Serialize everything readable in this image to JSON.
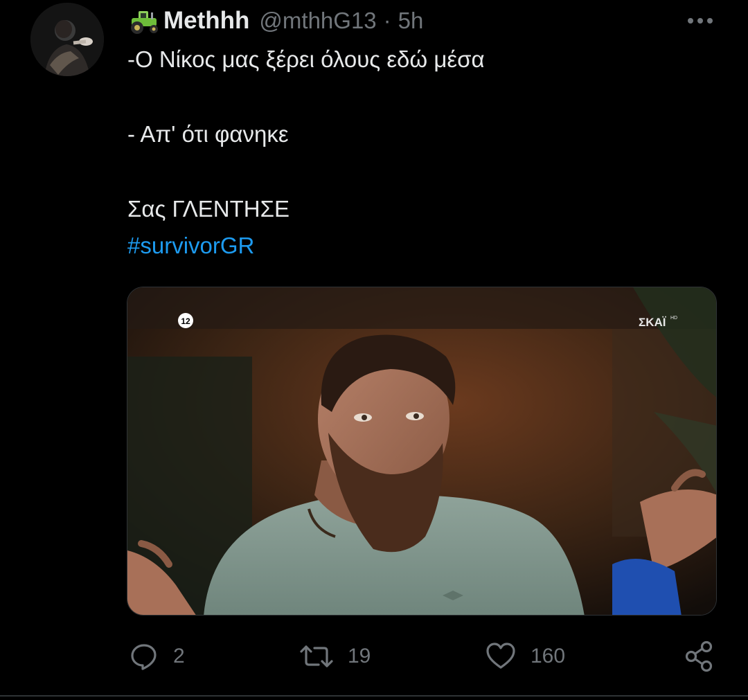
{
  "tweet": {
    "author": {
      "display_name": "Methhh",
      "handle": "@mthhG13",
      "name_emoji": "tractor-emoji"
    },
    "separator": "·",
    "time": "5h",
    "text_lines": [
      "-Ο Νίκος μας ξέρει όλους εδώ μέσα",
      "- Απ' ότι φανηκε",
      "Σας ΓΛΕΝΤΗΣΕ"
    ],
    "hashtag": "#survivorGR",
    "media": {
      "age_rating": "12",
      "channel_logo": "ΣΚΑΪ",
      "channel_logo_sup": "HD"
    },
    "actions": {
      "replies": "2",
      "retweets": "19",
      "likes": "160"
    }
  },
  "colors": {
    "background": "#000000",
    "primary_text": "#e7e9ea",
    "secondary_text": "#71767b",
    "link": "#1d9bf0",
    "border": "#2f3336"
  },
  "icons": {
    "reply": "reply-icon",
    "retweet": "retweet-icon",
    "like": "heart-icon",
    "share": "share-icon",
    "more": "more-options-icon"
  }
}
